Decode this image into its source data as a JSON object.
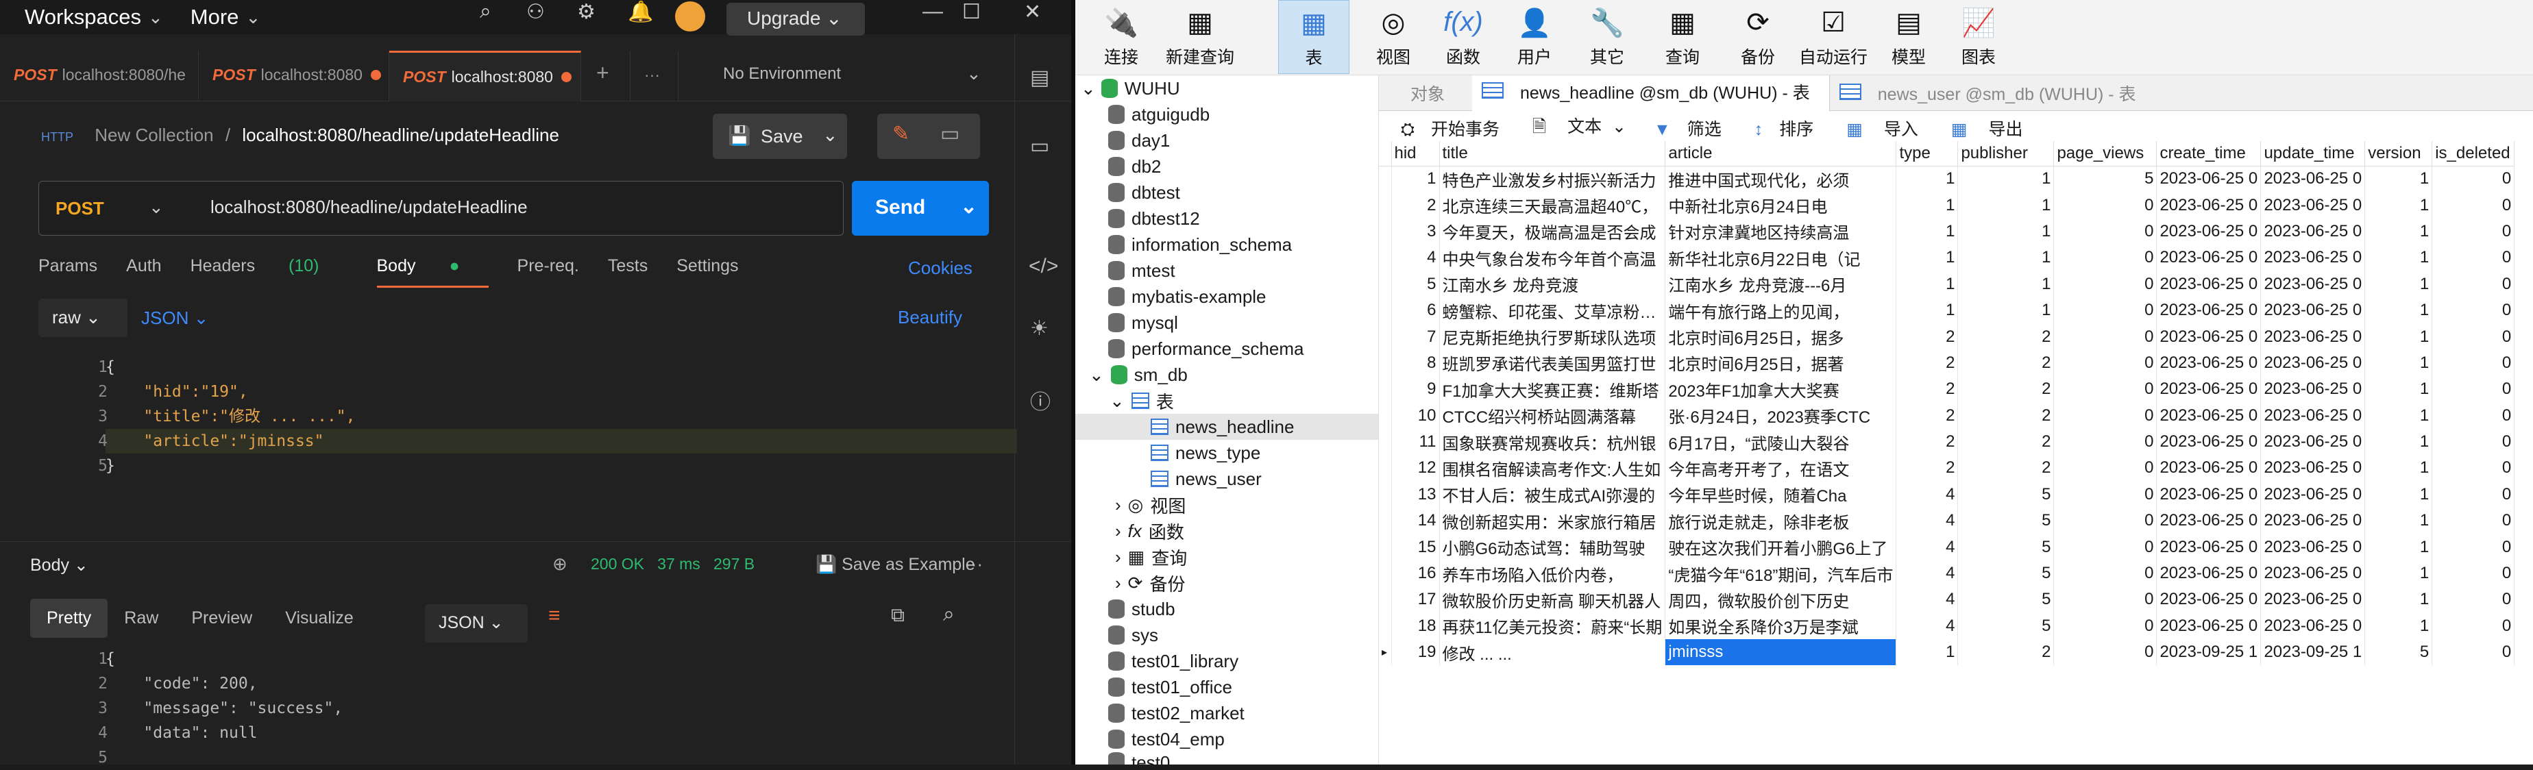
{
  "postman": {
    "topbar": {
      "workspaces": "Workspaces",
      "more": "More",
      "upgrade": "Upgrade"
    },
    "tabs": [
      {
        "method": "POST",
        "url": "localhost:8080/he"
      },
      {
        "method": "POST",
        "url": "localhost:8080"
      },
      {
        "method": "POST",
        "url": "localhost:8080"
      }
    ],
    "environment": "No Environment",
    "breadcrumb": {
      "collection": "New Collection",
      "sep": "/",
      "current": "localhost:8080/headline/updateHeadline"
    },
    "save_label": "Save",
    "request": {
      "method": "POST",
      "url": "localhost:8080/headline/updateHeadline",
      "send": "Send"
    },
    "req_tabs": {
      "params": "Params",
      "auth": "Auth",
      "headers": "Headers",
      "headers_count": "(10)",
      "body": "Body",
      "prereq": "Pre-req.",
      "tests": "Tests",
      "settings": "Settings",
      "cookies": "Cookies"
    },
    "body_mode": "raw",
    "body_lang": "JSON",
    "beautify": "Beautify",
    "editor_lines": [
      "1",
      "2",
      "3",
      "4",
      "5"
    ],
    "editor_code": [
      "{",
      "    \"hid\":\"19\",",
      "    \"title\":\"修改 ... ...\",",
      "    \"article\":\"jminsss\"",
      "}"
    ],
    "response": {
      "label": "Body",
      "status": "200 OK",
      "time": "37 ms",
      "size": "297 B",
      "save_example": "Save as Example",
      "tabs": {
        "pretty": "Pretty",
        "raw": "Raw",
        "preview": "Preview",
        "visualize": "Visualize"
      },
      "lang": "JSON",
      "lines": [
        "1",
        "2",
        "3",
        "4",
        "5"
      ],
      "code": [
        "{",
        "    \"code\": 200,",
        "    \"message\": \"success\",",
        "    \"data\": null",
        ""
      ]
    }
  },
  "navicat": {
    "toolbar": [
      "连接",
      "新建查询",
      "表",
      "视图",
      "函数",
      "用户",
      "其它",
      "查询",
      "备份",
      "自动运行",
      "模型",
      "图表"
    ],
    "tree": {
      "conn": "WUHU",
      "dbs": [
        "atguigudb",
        "day1",
        "db2",
        "dbtest",
        "dbtest12",
        "information_schema",
        "mtest",
        "mybatis-example",
        "mysql",
        "performance_schema"
      ],
      "open_db": "sm_db",
      "tables_label": "表",
      "tables": [
        "news_headline",
        "news_type",
        "news_user"
      ],
      "groups": [
        "视图",
        "函数",
        "查询",
        "备份"
      ],
      "more_dbs": [
        "studb",
        "sys",
        "test01_library",
        "test01_office",
        "test02_market",
        "test04_emp",
        "test0"
      ]
    },
    "tabs": {
      "objects": "对象",
      "tab1": "news_headline @sm_db (WUHU) - 表",
      "tab2": "news_user @sm_db (WUHU) - 表"
    },
    "subtoolbar": {
      "begin": "开始事务",
      "text": "文本",
      "filter": "筛选",
      "sort": "排序",
      "import": "导入",
      "export": "导出"
    },
    "columns": [
      "hid",
      "title",
      "article",
      "type",
      "publisher",
      "page_views",
      "create_time",
      "update_time",
      "version",
      "is_deleted"
    ],
    "rows": [
      [
        "1",
        "特色产业激发乡村振兴新活力",
        "推进中国式现代化，必须",
        "1",
        "1",
        "5",
        "2023-06-25 0",
        "2023-06-25 0",
        "1",
        "0"
      ],
      [
        "2",
        "北京连续三天最高温超40℃，",
        "中新社北京6月24日电",
        "1",
        "1",
        "0",
        "2023-06-25 0",
        "2023-06-25 0",
        "1",
        "0"
      ],
      [
        "3",
        "今年夏天，极端高温是否会成",
        "针对京津冀地区持续高温",
        "1",
        "1",
        "0",
        "2023-06-25 0",
        "2023-06-25 0",
        "1",
        "0"
      ],
      [
        "4",
        "中央气象台发布今年首个高温",
        "新华社北京6月22日电（记",
        "1",
        "1",
        "0",
        "2023-06-25 0",
        "2023-06-25 0",
        "1",
        "0"
      ],
      [
        "5",
        "江南水乡 龙舟竞渡",
        "江南水乡 龙舟竞渡---6月",
        "1",
        "1",
        "0",
        "2023-06-25 0",
        "2023-06-25 0",
        "1",
        "0"
      ],
      [
        "6",
        "螃蟹粽、印花蛋、艾草凉粉…",
        "端午有旅行路上的见闻，",
        "1",
        "1",
        "0",
        "2023-06-25 0",
        "2023-06-25 0",
        "1",
        "0"
      ],
      [
        "7",
        "尼克斯拒绝执行罗斯球队选项",
        "北京时间6月25日，据多",
        "2",
        "2",
        "0",
        "2023-06-25 0",
        "2023-06-25 0",
        "1",
        "0"
      ],
      [
        "8",
        "班凯罗承诺代表美国男篮打世",
        "北京时间6月25日，据著",
        "2",
        "2",
        "0",
        "2023-06-25 0",
        "2023-06-25 0",
        "1",
        "0"
      ],
      [
        "9",
        "F1加拿大大奖赛正赛：维斯塔",
        "2023年F1加拿大大奖赛",
        "2",
        "2",
        "0",
        "2023-06-25 0",
        "2023-06-25 0",
        "1",
        "0"
      ],
      [
        "10",
        "CTCC绍兴柯桥站圆满落幕",
        "张·6月24日，2023赛季CTC",
        "2",
        "2",
        "0",
        "2023-06-25 0",
        "2023-06-25 0",
        "1",
        "0"
      ],
      [
        "11",
        "国象联赛常规赛收兵：杭州银",
        "6月17日，“武陵山大裂谷",
        "2",
        "2",
        "0",
        "2023-06-25 0",
        "2023-06-25 0",
        "1",
        "0"
      ],
      [
        "12",
        "围棋名宿解读高考作文:人生如",
        "今年高考开考了，在语文",
        "2",
        "2",
        "0",
        "2023-06-25 0",
        "2023-06-25 0",
        "1",
        "0"
      ],
      [
        "13",
        "不甘人后：被生成式AI弥漫的",
        "今年早些时候，随着Cha",
        "4",
        "5",
        "0",
        "2023-06-25 0",
        "2023-06-25 0",
        "1",
        "0"
      ],
      [
        "14",
        "微创新超实用：米家旅行箱居",
        "旅行说走就走，除非老板",
        "4",
        "5",
        "0",
        "2023-06-25 0",
        "2023-06-25 0",
        "1",
        "0"
      ],
      [
        "15",
        "小鹏G6动态试驾：辅助驾驶",
        "驶在这次我们开着小鹏G6上了",
        "4",
        "5",
        "0",
        "2023-06-25 0",
        "2023-06-25 0",
        "1",
        "0"
      ],
      [
        "16",
        "养车市场陷入低价内卷，",
        "“虎猫今年“618”期间，汽车后市",
        "4",
        "5",
        "0",
        "2023-06-25 0",
        "2023-06-25 0",
        "1",
        "0"
      ],
      [
        "17",
        "微软股价历史新高 聊天机器人",
        "周四，微软股价创下历史",
        "4",
        "5",
        "0",
        "2023-06-25 0",
        "2023-06-25 0",
        "1",
        "0"
      ],
      [
        "18",
        "再获11亿美元投资：蔚来“长期",
        "如果说全系降价3万是李斌",
        "4",
        "5",
        "0",
        "2023-06-25 0",
        "2023-06-25 0",
        "1",
        "0"
      ],
      [
        "19",
        "修改 ... ...",
        "jminsss",
        "1",
        "2",
        "0",
        "2023-09-25 1",
        "2023-09-25 1",
        "5",
        "0"
      ]
    ]
  }
}
